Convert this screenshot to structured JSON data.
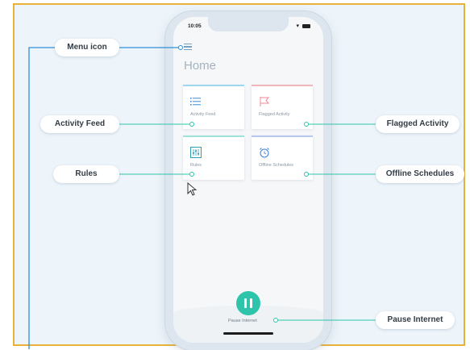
{
  "callouts": {
    "menu_icon": "Menu icon",
    "activity_feed": "Activity Feed",
    "flagged_activity": "Flagged Activity",
    "rules": "Rules",
    "offline_schedules": "Offline Schedules",
    "pause_internet": "Pause Internet"
  },
  "phone": {
    "time": "10:05",
    "title": "Home",
    "tiles": [
      {
        "label": "Activity Feed",
        "icon": "list-icon"
      },
      {
        "label": "Flagged Activity",
        "icon": "flag-icon"
      },
      {
        "label": "Rules",
        "icon": "sliders-icon"
      },
      {
        "label": "Offline Schedules",
        "icon": "alarm-clock-icon"
      }
    ],
    "pause_label": "Pause Internet"
  },
  "colors": {
    "accent": "#2ec4aa",
    "frame_border": "#e8b23a",
    "background": "#edf4fa",
    "menu_line": "#2f8fd6",
    "flag_pink": "#f0a0a8",
    "rules_teal": "#7ad6c9"
  }
}
